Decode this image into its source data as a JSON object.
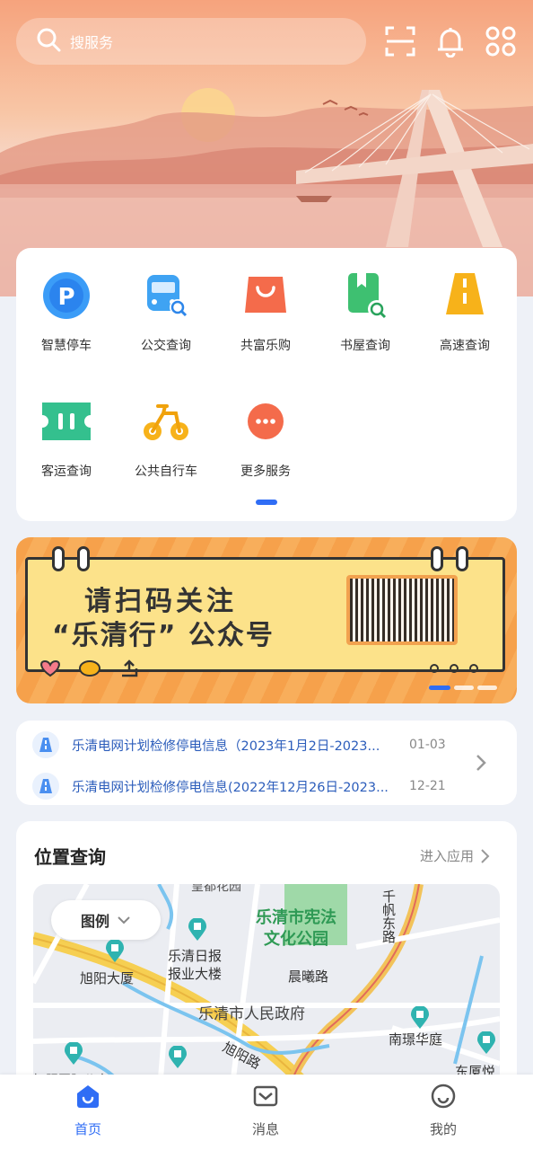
{
  "search": {
    "placeholder": "搜服务",
    "icon": "search-icon"
  },
  "top_icons": [
    "scan-icon",
    "bell-icon",
    "apps-grid-icon"
  ],
  "services": [
    {
      "label": "智慧停车",
      "icon": "parking-icon"
    },
    {
      "label": "公交查询",
      "icon": "bus-icon"
    },
    {
      "label": "共富乐购",
      "icon": "shopping-bag-icon"
    },
    {
      "label": "书屋查询",
      "icon": "book-search-icon"
    },
    {
      "label": "高速查询",
      "icon": "highway-icon"
    },
    {
      "label": "客运查询",
      "icon": "ticket-icon"
    },
    {
      "label": "公共自行车",
      "icon": "bicycle-icon"
    },
    {
      "label": "更多服务",
      "icon": "more-icon"
    }
  ],
  "banner": {
    "line1": "请扫码关注",
    "line2": "“乐清行” 公众号"
  },
  "news": [
    {
      "title": "乐清电网计划检修停电信息（2023年1月2日-2023...",
      "date": "01-03"
    },
    {
      "title": "乐清电网计划检修停电信息(2022年12月26日-2023...",
      "date": "12-21"
    }
  ],
  "location": {
    "title": "位置查询",
    "enter_label": "进入应用",
    "legend_label": "图例",
    "map_labels": {
      "park": "乐清市宪法\n文化公园",
      "daily": "乐清日报\n报业大楼",
      "xuyang_bldg": "旭阳大厦",
      "gov": "乐清市人民政府",
      "chenxi_road": "晨曦路",
      "xuyang_road": "旭阳路",
      "qianfan_road": "千帆东路",
      "nanhuan": "南璟华庭",
      "dongsha": "东厦悦",
      "top_garden": "皇都花园",
      "intl": "旭阳国际公寓"
    }
  },
  "tabs": [
    {
      "label": "首页",
      "icon": "home-icon",
      "active": true
    },
    {
      "label": "消息",
      "icon": "message-icon",
      "active": false
    },
    {
      "label": "我的",
      "icon": "profile-icon",
      "active": false
    }
  ],
  "colors": {
    "accent": "#2f6df5",
    "news_text": "#2c5dbb",
    "park": "#2f9a55"
  }
}
